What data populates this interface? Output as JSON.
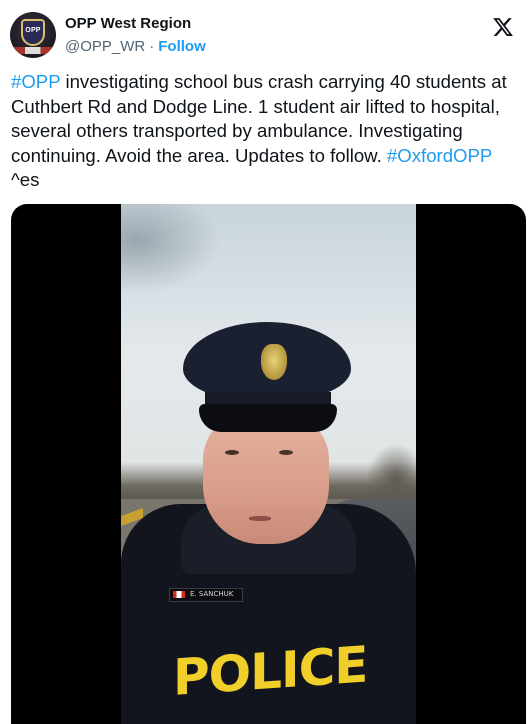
{
  "author": {
    "display_name": "OPP West Region",
    "handle": "@OPP_WR",
    "separator": "·",
    "follow_label": "Follow",
    "avatar_text": "OPP"
  },
  "platform": {
    "logo_icon": "x-logo-icon"
  },
  "tweet": {
    "hashtag_opp": "#OPP",
    "text_part1": " investigating school bus crash carrying 40 students at Cuthbert Rd and Dodge Line. 1 student air lifted to hospital, several others transported by ambulance. Investigating continuing.  Avoid the area. Updates to follow. ",
    "hashtag_oxford": "#OxfordOPP",
    "text_part2": " ^es"
  },
  "media": {
    "type": "video",
    "nametag": "E. SANCHUK",
    "vest_text": "POLICE"
  },
  "colors": {
    "accent": "#1d9bf0",
    "text": "#0f1419",
    "muted": "#536471"
  }
}
